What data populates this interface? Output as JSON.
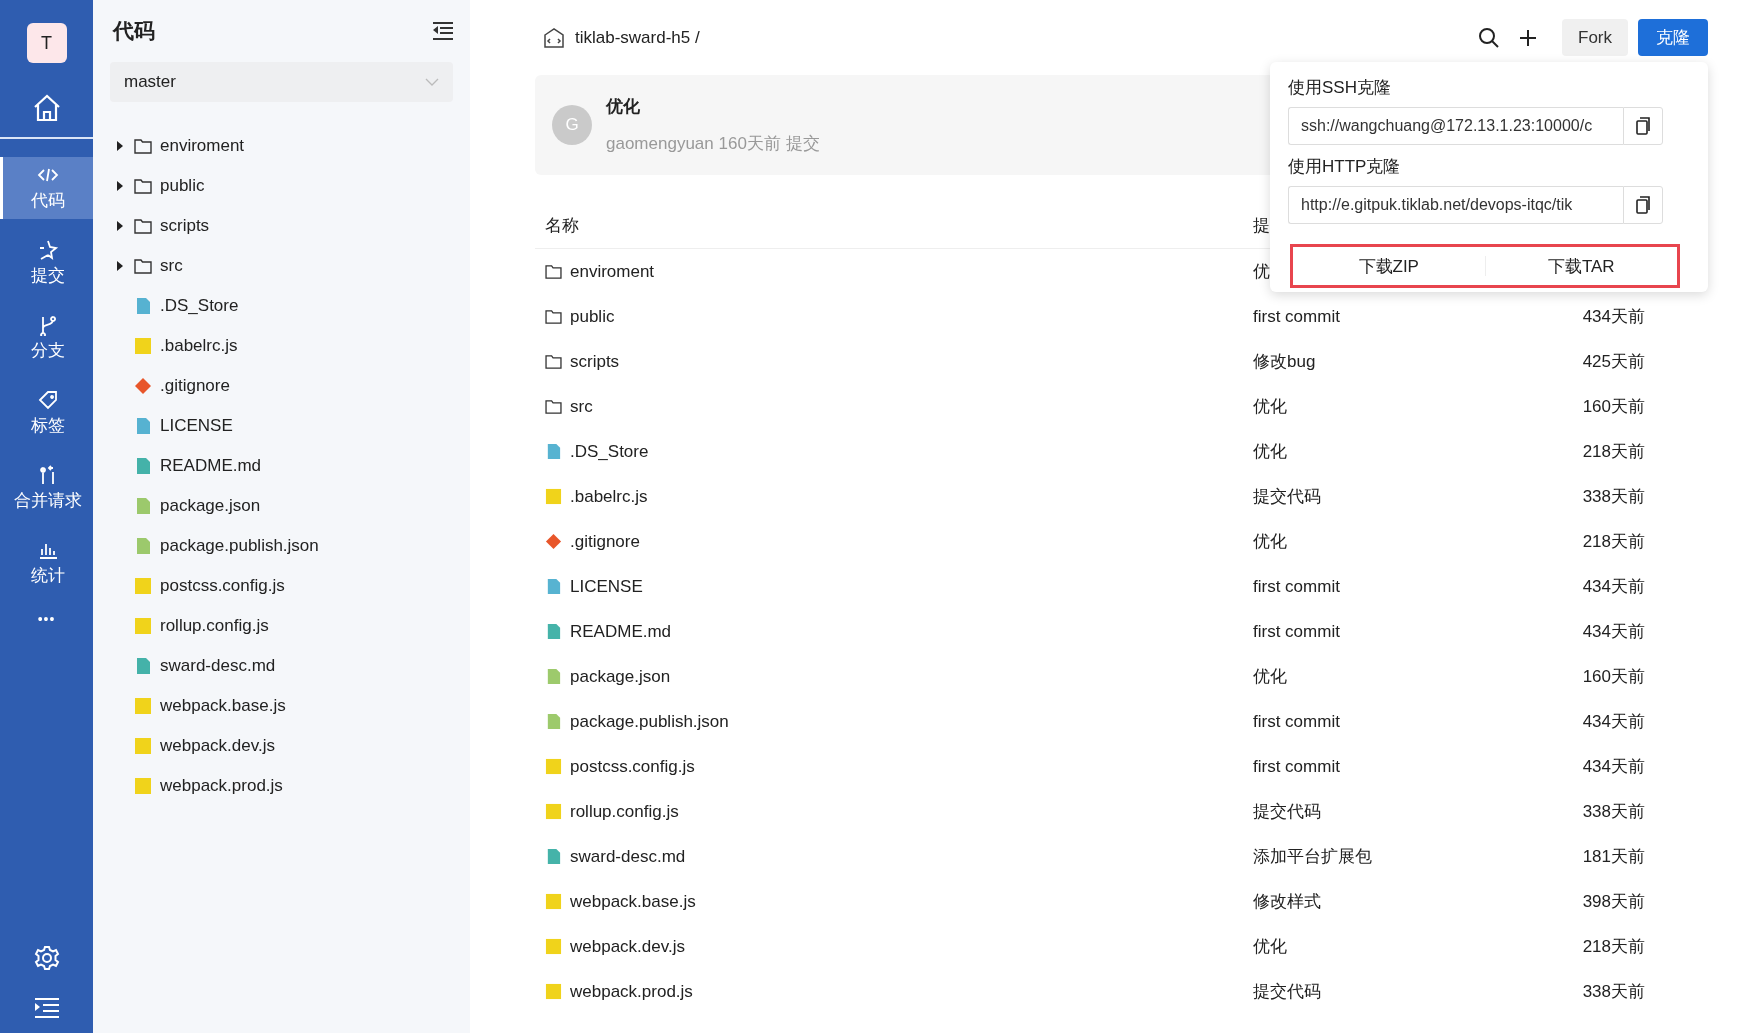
{
  "nav": {
    "avatar": "T",
    "items": [
      {
        "kind": "code",
        "label": "代码",
        "selected": true
      },
      {
        "kind": "commit",
        "label": "提交",
        "selected": false
      },
      {
        "kind": "branch",
        "label": "分支",
        "selected": false
      },
      {
        "kind": "tag",
        "label": "标签",
        "selected": false
      },
      {
        "kind": "merge",
        "label": "合并请求",
        "selected": false
      },
      {
        "kind": "stats",
        "label": "统计",
        "selected": false
      }
    ],
    "more": "•••"
  },
  "tree_panel": {
    "title": "代码",
    "branch": "master",
    "items": [
      {
        "kind": "folder",
        "name": "enviroment",
        "expanded": false
      },
      {
        "kind": "folder",
        "name": "public",
        "expanded": false
      },
      {
        "kind": "folder",
        "name": "scripts",
        "expanded": false
      },
      {
        "kind": "folder",
        "name": "src",
        "expanded": false
      },
      {
        "kind": "doc",
        "name": ".DS_Store"
      },
      {
        "kind": "js",
        "name": ".babelrc.js"
      },
      {
        "kind": "git",
        "name": ".gitignore"
      },
      {
        "kind": "doc",
        "name": "LICENSE"
      },
      {
        "kind": "md",
        "name": "README.md"
      },
      {
        "kind": "json",
        "name": "package.json"
      },
      {
        "kind": "json",
        "name": "package.publish.json"
      },
      {
        "kind": "js",
        "name": "postcss.config.js"
      },
      {
        "kind": "js",
        "name": "rollup.config.js"
      },
      {
        "kind": "md",
        "name": "sward-desc.md"
      },
      {
        "kind": "js",
        "name": "webpack.base.js"
      },
      {
        "kind": "js",
        "name": "webpack.dev.js"
      },
      {
        "kind": "js",
        "name": "webpack.prod.js"
      }
    ]
  },
  "header": {
    "repo": "tiklab-sward-h5 /",
    "fork_button": "Fork",
    "clone_button": "克隆"
  },
  "last_commit": {
    "avatar": "G",
    "message": "优化",
    "meta": "gaomengyuan 160天前 提交"
  },
  "table": {
    "columns": [
      "名称",
      "提"
    ],
    "rows": [
      {
        "kind": "folder",
        "name": "enviroment",
        "commit": "优"
      },
      {
        "kind": "folder",
        "name": "public",
        "commit": "first commit",
        "time": "434天前"
      },
      {
        "kind": "folder",
        "name": "scripts",
        "commit": "修改bug",
        "time": "425天前"
      },
      {
        "kind": "folder",
        "name": "src",
        "commit": "优化",
        "time": "160天前"
      },
      {
        "kind": "doc",
        "name": ".DS_Store",
        "commit": "优化",
        "time": "218天前"
      },
      {
        "kind": "js",
        "name": ".babelrc.js",
        "commit": "提交代码",
        "time": "338天前"
      },
      {
        "kind": "git",
        "name": ".gitignore",
        "commit": "优化",
        "time": "218天前"
      },
      {
        "kind": "doc",
        "name": "LICENSE",
        "commit": "first commit",
        "time": "434天前"
      },
      {
        "kind": "md",
        "name": "README.md",
        "commit": "first commit",
        "time": "434天前"
      },
      {
        "kind": "json",
        "name": "package.json",
        "commit": "优化",
        "time": "160天前"
      },
      {
        "kind": "json",
        "name": "package.publish.json",
        "commit": "first commit",
        "time": "434天前"
      },
      {
        "kind": "js",
        "name": "postcss.config.js",
        "commit": "first commit",
        "time": "434天前"
      },
      {
        "kind": "js",
        "name": "rollup.config.js",
        "commit": "提交代码",
        "time": "338天前"
      },
      {
        "kind": "md",
        "name": "sward-desc.md",
        "commit": "添加平台扩展包",
        "time": "181天前"
      },
      {
        "kind": "js",
        "name": "webpack.base.js",
        "commit": "修改样式",
        "time": "398天前"
      },
      {
        "kind": "js",
        "name": "webpack.dev.js",
        "commit": "优化",
        "time": "218天前"
      },
      {
        "kind": "js",
        "name": "webpack.prod.js",
        "commit": "提交代码",
        "time": "338天前"
      }
    ]
  },
  "clone_popover": {
    "ssh_label": "使用SSH克隆",
    "ssh_url": "ssh://wangchuang@172.13.1.23:10000/c",
    "http_label": "使用HTTP克隆",
    "http_url": "http://e.gitpuk.tiklab.net/devops-itqc/tik",
    "downloads": [
      "下载ZIP",
      "下载TAR"
    ]
  }
}
